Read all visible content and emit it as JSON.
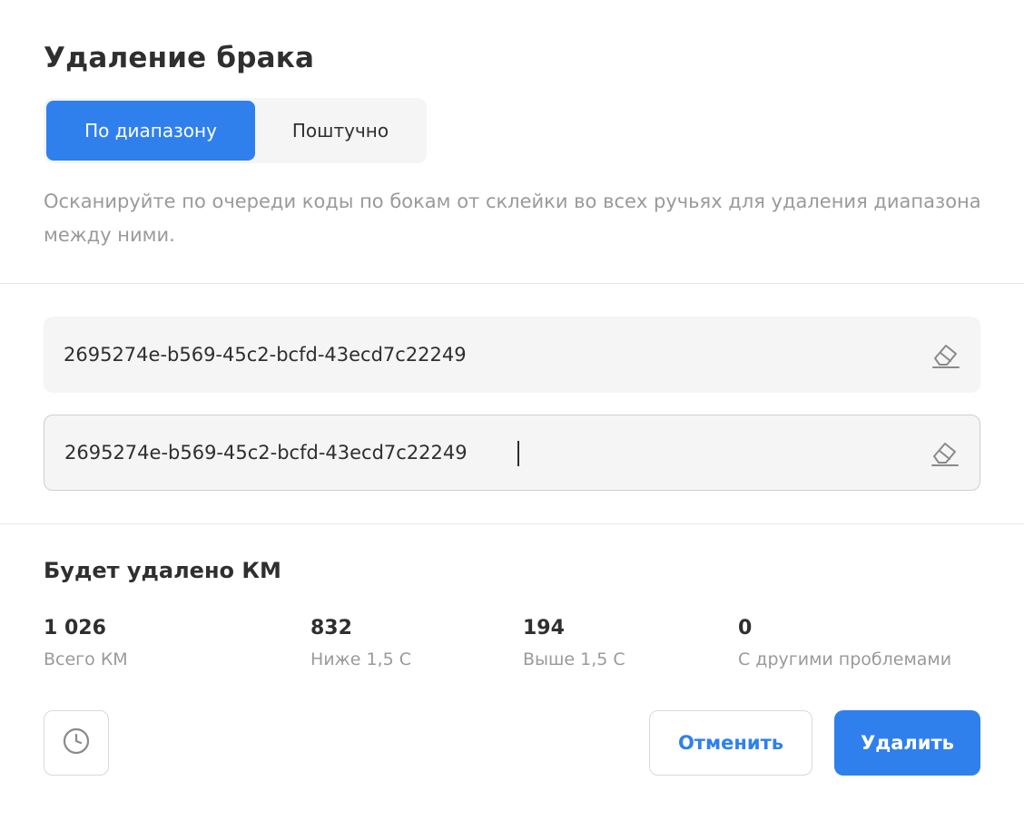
{
  "dialog": {
    "title": "Удаление брака"
  },
  "mode_tabs": {
    "by_range": "По диапазону",
    "by_piece": "Поштучно",
    "selected": "По диапазону"
  },
  "hint": "Осканируйте по очереди коды по бокам от склейки во всех ручьях для удаления диапазона между ними.",
  "fields": [
    {
      "value": "2695274e-b569-45c2-bcfd-43ecd7c22249",
      "clear_icon": "eraser-icon"
    },
    {
      "value": "2695274e-b569-45c2-bcfd-43ecd7c22249",
      "clear_icon": "eraser-icon",
      "focused": true
    }
  ],
  "summary": {
    "title": "Будет удалено КМ",
    "stats": [
      {
        "value": "1 026",
        "label": "Всего КМ"
      },
      {
        "value": "832",
        "label": "Ниже 1,5 С"
      },
      {
        "value": "194",
        "label": "Выше 1,5 С"
      },
      {
        "value": "0",
        "label": "С другими проблемами"
      }
    ]
  },
  "actions": {
    "history_icon": "clock-icon",
    "cancel_label": "Отменить",
    "delete_label": "Удалить"
  },
  "colors": {
    "accent": "#2f80ed",
    "muted_text": "#9a9a9a",
    "field_bg": "#f5f5f5"
  }
}
